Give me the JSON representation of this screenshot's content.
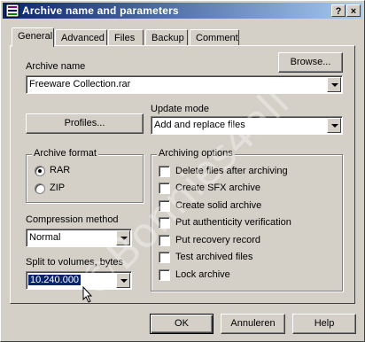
{
  "window": {
    "title": "Archive name and parameters",
    "help_btn": "?",
    "close_btn": "×"
  },
  "tabs": [
    "General",
    "Advanced",
    "Files",
    "Backup",
    "Comment"
  ],
  "archive_name": {
    "label": "Archive name",
    "browse_label": "Browse...",
    "value": "Freeware Collection.rar"
  },
  "profiles_label": "Profiles...",
  "update_mode": {
    "label": "Update mode",
    "value": "Add and replace files"
  },
  "archive_format": {
    "label": "Archive format",
    "options": [
      "RAR",
      "ZIP"
    ],
    "selected": "RAR"
  },
  "compression": {
    "label": "Compression method",
    "value": "Normal"
  },
  "split": {
    "label": "Split to volumes, bytes",
    "value": "10.240.000"
  },
  "archiving_options": {
    "label": "Archiving options",
    "items": [
      "Delete files after archiving",
      "Create SFX archive",
      "Create solid archive",
      "Put authenticity verification",
      "Put recovery record",
      "Test archived files",
      "Lock archive"
    ]
  },
  "buttons": {
    "ok": "OK",
    "cancel": "Annuleren",
    "help": "Help"
  },
  "watermark": "©Bonnies4all",
  "colors": {
    "titlebar_start": "#0a246a",
    "titlebar_end": "#a6caf0",
    "face": "#d4d0c8",
    "selection": "#0a246a"
  }
}
